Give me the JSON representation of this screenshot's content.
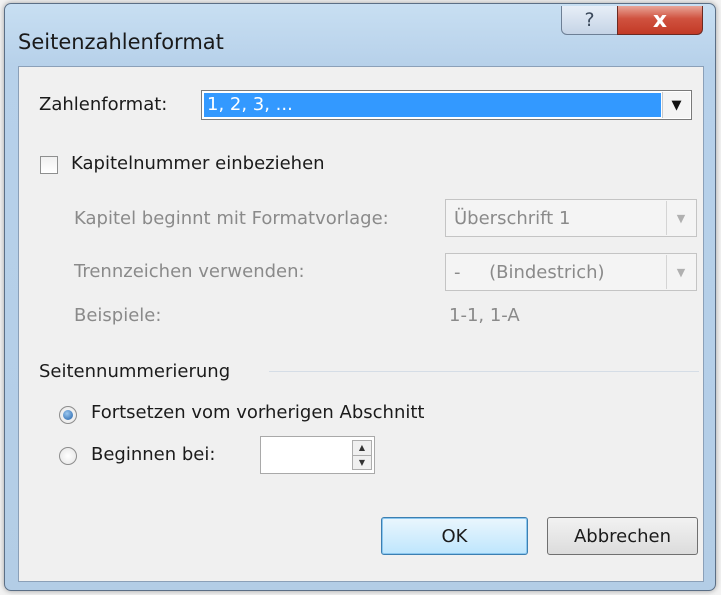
{
  "window": {
    "title": "Seitenzahlenformat",
    "help_label": "?",
    "close_label": "x"
  },
  "number_format": {
    "label": "Zahlenformat:",
    "value": "1, 2, 3, ..."
  },
  "include_chapter": {
    "label": "Kapitelnummer einbeziehen",
    "checked": false
  },
  "chapter_style": {
    "label": "Kapitel beginnt mit Formatvorlage:",
    "value": "Überschrift 1"
  },
  "separator": {
    "label": "Trennzeichen verwenden:",
    "value": "-     (Bindestrich)"
  },
  "examples": {
    "label": "Beispiele:",
    "value": "1-1, 1-A"
  },
  "page_numbering": {
    "heading": "Seitennummerierung",
    "continue_label": "Fortsetzen vom vorherigen Abschnitt",
    "start_at_label": "Beginnen bei:",
    "start_at_value": "",
    "selected": "continue"
  },
  "buttons": {
    "ok": "OK",
    "cancel": "Abbrechen"
  },
  "colors": {
    "selection": "#3399ff",
    "close_button": "#c23a26",
    "frame": "#b7d1ea"
  }
}
